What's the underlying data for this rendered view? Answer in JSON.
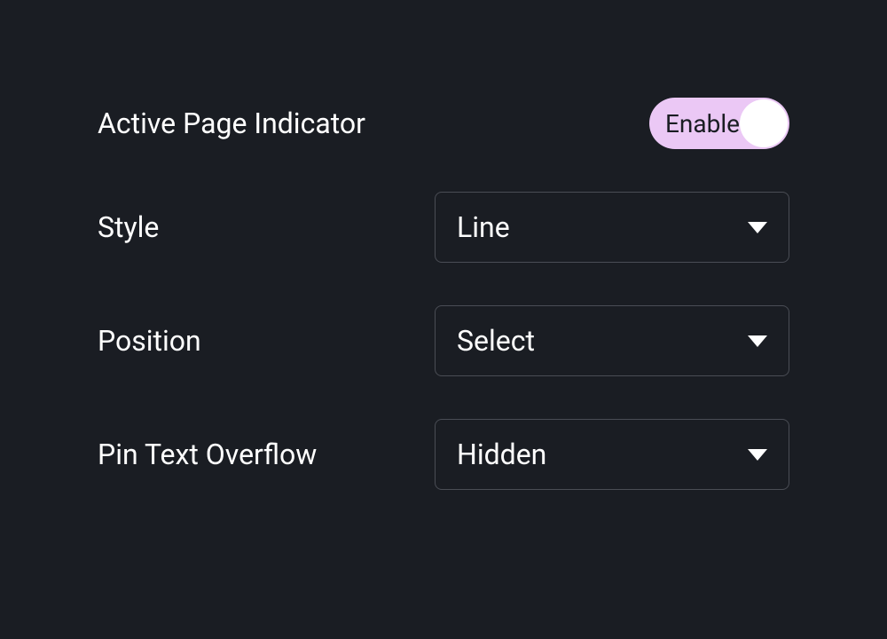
{
  "settings": {
    "activePageIndicator": {
      "label": "Active Page Indicator",
      "toggleLabel": "Enable",
      "enabled": true
    },
    "style": {
      "label": "Style",
      "value": "Line"
    },
    "position": {
      "label": "Position",
      "value": "Select"
    },
    "pinTextOverflow": {
      "label": "Pin Text Overflow",
      "value": "Hidden"
    }
  }
}
